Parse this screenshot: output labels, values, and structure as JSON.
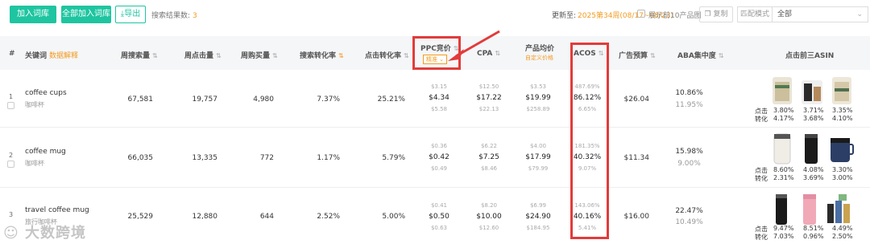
{
  "toolbar": {
    "add_label": "加入词库",
    "add_all_label": "全部加入词库",
    "export_label": "导出",
    "search_result_label": "搜索结果数:",
    "search_result_count": "3",
    "update_label": "更新至:",
    "update_value": "2025第34周(08/17~08/23)",
    "show_top10_label": "展示前10产品图",
    "copy_label": "复制",
    "match_mode_label": "匹配模式",
    "match_mode_value": "全部"
  },
  "header": {
    "idx": "#",
    "keyword": "关键词",
    "keyword_link": "数据解释",
    "weekly_search": "周搜索量",
    "weekly_clicks": "周点击量",
    "weekly_purchases": "周购买量",
    "search_conv": "搜索转化率",
    "click_conv": "点击转化率",
    "ppc_bid": "PPC竞价",
    "ppc_tag": "精准",
    "cpa": "CPA",
    "avg_price": "产品均价",
    "avg_price_sub": "自定义价格",
    "acos": "ACOS",
    "ad_budget": "广告预算",
    "aba_concentration": "ABA集中度",
    "top3_asin": "点击前三ASIN"
  },
  "asin_labels": {
    "click": "点击",
    "conv": "转化"
  },
  "rows": [
    {
      "idx": "1",
      "keyword": "coffee cups",
      "keyword_cn": "咖啡杯",
      "weekly_search": "67,581",
      "weekly_clicks": "19,757",
      "weekly_purchases": "4,980",
      "search_conv": "7.37%",
      "click_conv": "25.21%",
      "ppc": [
        "$3.15",
        "$4.34",
        "$5.58"
      ],
      "cpa": [
        "$12.50",
        "$17.22",
        "$22.13"
      ],
      "price": [
        "$3.53",
        "$19.99",
        "$258.89"
      ],
      "acos": [
        "487.69%",
        "86.12%",
        "6.65%"
      ],
      "ad_budget": "$26.04",
      "aba": [
        "10.86%",
        "11.95%"
      ],
      "asins": [
        {
          "click": "3.80%",
          "conv": "4.17%"
        },
        {
          "click": "3.71%",
          "conv": "3.68%"
        },
        {
          "click": "3.35%",
          "conv": "4.10%"
        }
      ]
    },
    {
      "idx": "2",
      "keyword": "coffee mug",
      "keyword_cn": "咖啡杯",
      "weekly_search": "66,035",
      "weekly_clicks": "13,335",
      "weekly_purchases": "772",
      "search_conv": "1.17%",
      "click_conv": "5.79%",
      "ppc": [
        "$0.36",
        "$0.42",
        "$0.49"
      ],
      "cpa": [
        "$6.22",
        "$7.25",
        "$8.46"
      ],
      "price": [
        "$4.00",
        "$17.99",
        "$79.99"
      ],
      "acos": [
        "181.35%",
        "40.32%",
        "9.07%"
      ],
      "ad_budget": "$11.34",
      "aba": [
        "15.98%",
        "9.00%"
      ],
      "asins": [
        {
          "click": "8.60%",
          "conv": "2.31%"
        },
        {
          "click": "4.08%",
          "conv": "3.69%"
        },
        {
          "click": "3.30%",
          "conv": "3.00%"
        }
      ]
    },
    {
      "idx": "3",
      "keyword": "travel coffee mug",
      "keyword_cn": "旅行咖啡杯",
      "weekly_search": "25,529",
      "weekly_clicks": "12,880",
      "weekly_purchases": "644",
      "search_conv": "2.52%",
      "click_conv": "5.00%",
      "ppc": [
        "$0.41",
        "$0.50",
        "$0.63"
      ],
      "cpa": [
        "$8.20",
        "$10.00",
        "$12.60"
      ],
      "price": [
        "$6.99",
        "$24.90",
        "$184.95"
      ],
      "acos": [
        "143.06%",
        "40.16%",
        "5.41%"
      ],
      "ad_budget": "$16.00",
      "aba": [
        "22.47%",
        "10.49%"
      ],
      "asins": [
        {
          "click": "9.47%",
          "conv": "7.03%"
        },
        {
          "click": "8.51%",
          "conv": "0.96%"
        },
        {
          "click": "4.49%",
          "conv": "2.50%"
        }
      ]
    }
  ],
  "watermark": "大数跨境",
  "colors": {
    "accent_green": "#1ec5a0",
    "accent_orange": "#f39a1e",
    "highlight_red": "#e23b3b"
  }
}
